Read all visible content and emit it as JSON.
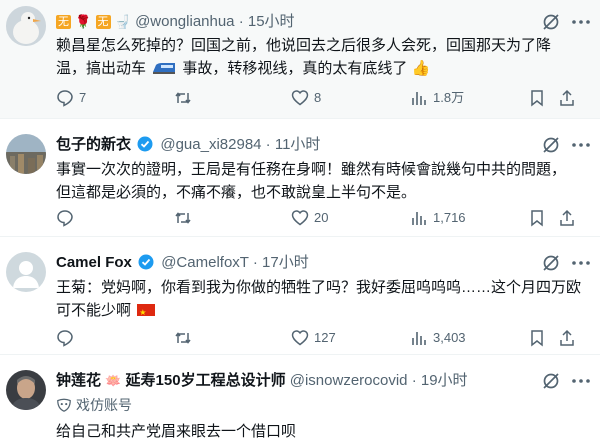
{
  "tweets": [
    {
      "name_prefix": "无",
      "name_mid": "无",
      "handle": "@wonglianhua",
      "time": "· 15小时",
      "text_1": "赖昌星怎么死掉的？回国之前，他说回去之后很多人会死，回国那天为了降",
      "text_2a": "温，搞出动车",
      "text_2b": "事故，转移视线，真的太有底线了",
      "reply": "7",
      "retweet": "",
      "like": "8",
      "views": "1.8万"
    },
    {
      "name": "包子的新衣",
      "handle": "@gua_xi82984",
      "time": "· 11小时",
      "text_1": "事實一次次的證明，王局是有任務在身啊！雖然有時候會說幾句中共的問題，",
      "text_2": "但這都是必須的，不痛不癢，也不敢說皇上半句不是。",
      "reply": "",
      "retweet": "",
      "like": "20",
      "views": "1,716"
    },
    {
      "name": "Camel Fox",
      "handle": "@CamelfoxT",
      "time": "· 17小时",
      "text_1": "王菊：党妈啊，你看到我为你做的牺牲了吗？我好委屈呜呜呜……这个月四万欧",
      "text_2": "可不能少啊",
      "reply": "",
      "retweet": "",
      "like": "127",
      "views": "3,403"
    },
    {
      "name_a": "钟莲花",
      "name_b": "延寿150岁工程总设计师",
      "handle": "@isnowzerocovid",
      "time": "· 19小时",
      "label": "戏仿账号",
      "text_1": "给自己和共产党眉来眼去一个借口呗"
    }
  ],
  "colors": {
    "verified": "#1d9bf0",
    "muted": "#536471",
    "text": "#0f1419",
    "divider": "#eff3f4"
  }
}
